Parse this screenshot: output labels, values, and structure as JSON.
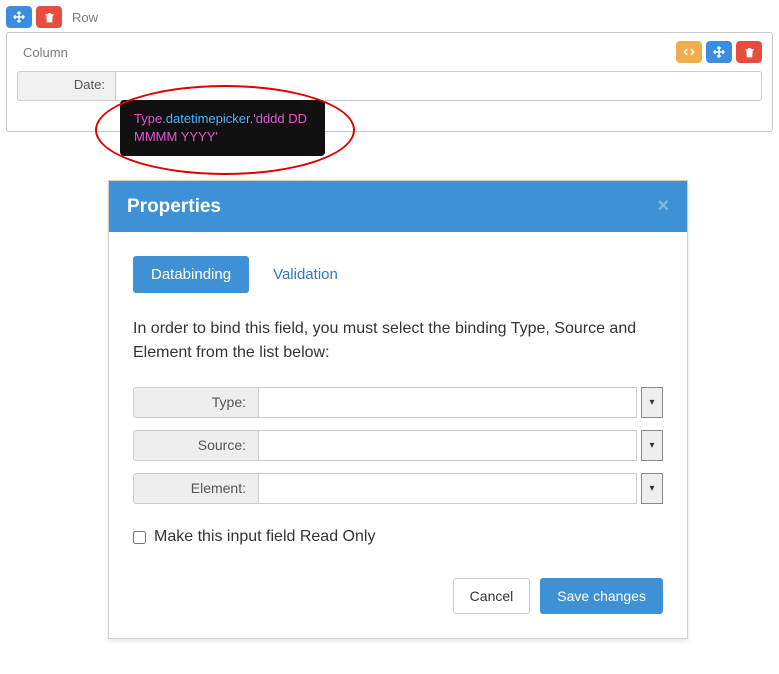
{
  "row": {
    "label": "Row"
  },
  "column": {
    "label": "Column",
    "field_label": "Date:",
    "field_value": ""
  },
  "tooltip": {
    "part1": "Type",
    "part2": ".datetimepicker.",
    "part3": "'dddd DD MMMM YYYY'"
  },
  "modal": {
    "title": "Properties",
    "tabs": {
      "databinding": "Databinding",
      "validation": "Validation"
    },
    "instruction": "In order to bind this field, you must select the binding Type, Source and Element from the list below:",
    "fields": {
      "type_label": "Type:",
      "type_value": "",
      "source_label": "Source:",
      "source_value": "",
      "element_label": "Element:",
      "element_value": ""
    },
    "readonly_label": "Make this input field Read Only",
    "cancel": "Cancel",
    "save": "Save changes"
  }
}
